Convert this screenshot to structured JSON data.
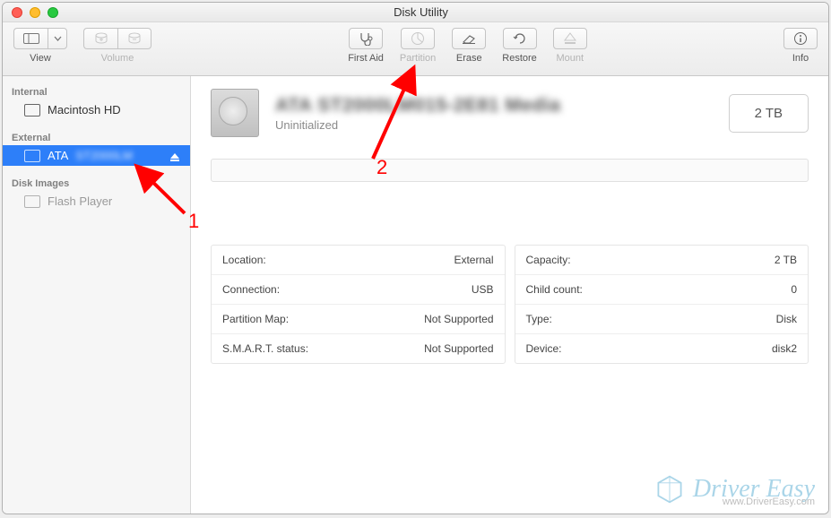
{
  "window": {
    "title": "Disk Utility"
  },
  "toolbar": {
    "view_label": "View",
    "volume_label": "Volume",
    "first_aid_label": "First Aid",
    "partition_label": "Partition",
    "erase_label": "Erase",
    "restore_label": "Restore",
    "mount_label": "Mount",
    "info_label": "Info"
  },
  "sidebar": {
    "internal_hdr": "Internal",
    "internal_item": "Macintosh HD",
    "external_hdr": "External",
    "external_item": "ATA",
    "images_hdr": "Disk Images",
    "images_item": "Flash Player"
  },
  "drive": {
    "name": "ATA ST2000LM015-2E81 Media",
    "status": "Uninitialized",
    "capacity_btn": "2 TB"
  },
  "info_left": [
    {
      "k": "Location:",
      "v": "External"
    },
    {
      "k": "Connection:",
      "v": "USB"
    },
    {
      "k": "Partition Map:",
      "v": "Not Supported"
    },
    {
      "k": "S.M.A.R.T. status:",
      "v": "Not Supported"
    }
  ],
  "info_right": [
    {
      "k": "Capacity:",
      "v": "2 TB"
    },
    {
      "k": "Child count:",
      "v": "0"
    },
    {
      "k": "Type:",
      "v": "Disk"
    },
    {
      "k": "Device:",
      "v": "disk2"
    }
  ],
  "annotations": {
    "n1": "1",
    "n2": "2"
  },
  "watermark": {
    "name": "Driver Easy",
    "url": "www.DriverEasy.com"
  }
}
